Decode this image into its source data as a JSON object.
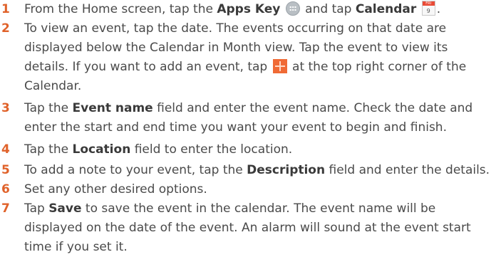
{
  "steps": [
    {
      "num": "1",
      "parts": {
        "a": "From the Home screen, tap the ",
        "b": "Apps Key",
        "c": " and tap ",
        "d": "Calendar",
        "e": "."
      },
      "icons": {
        "apps": "apps-key-icon",
        "calendar": "calendar-app-icon"
      },
      "calendar_icon_top": "FRI",
      "calendar_icon_day": "9"
    },
    {
      "num": "2",
      "parts": {
        "a": "To view an event, tap the date. The events occurring on that date are displayed below the Calendar in Month view. Tap the event to view its details. If you want to add an event, tap ",
        "b": " at the top right corner of the Calendar."
      },
      "icons": {
        "add": "add-plus-icon"
      }
    },
    {
      "num": "3",
      "parts": {
        "a": "Tap the ",
        "b": "Event name",
        "c": " field and enter the event name. Check the date and enter the start and end time you want your event to begin and finish."
      }
    },
    {
      "num": "4",
      "parts": {
        "a": "Tap the ",
        "b": "Location",
        "c": " field to enter the location."
      }
    },
    {
      "num": "5",
      "parts": {
        "a": "To add a note to your event, tap the ",
        "b": "Description",
        "c": " field and enter the details."
      }
    },
    {
      "num": "6",
      "parts": {
        "a": "Set any other desired options."
      }
    },
    {
      "num": "7",
      "parts": {
        "a": "Tap ",
        "b": "Save",
        "c": " to save the event in the calendar. The event name will be displayed on the date of the event. An alarm will sound at the event start time if you set it."
      }
    }
  ],
  "colors": {
    "number": "#e0622a",
    "text": "#4a4a4a",
    "plus_icon": "#f06a35"
  }
}
